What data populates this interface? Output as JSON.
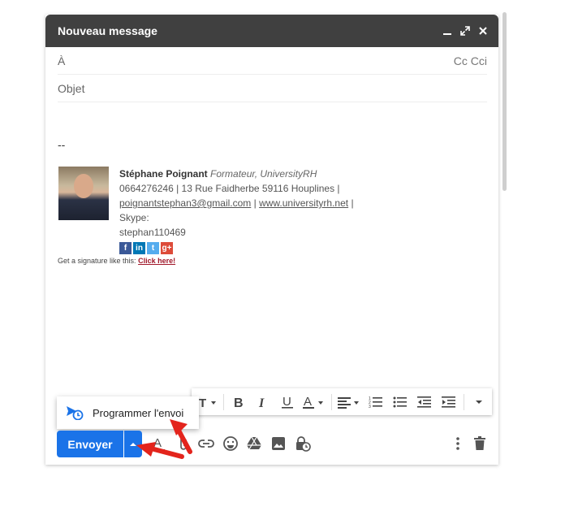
{
  "compose": {
    "title": "Nouveau message",
    "to_label": "À",
    "cc_bcc_label": "Cc Cci",
    "subject_placeholder": "Objet"
  },
  "signature": {
    "separator": "--",
    "name": "Stéphane Poignant",
    "role": "Formateur, UniversityRH",
    "line1": "0664276246 | 13 Rue Faidherbe 59116 Houplines |",
    "email": "poignantstephan3@gmail.com",
    "sep_pipe": " | ",
    "website": "www.universityrh.net",
    "skype_label": " | Skype:",
    "skype_id": "stephan110469",
    "social": [
      {
        "icon": "facebook-icon",
        "letter": "f",
        "color": "#3b5998"
      },
      {
        "icon": "linkedin-icon",
        "letter": "in",
        "color": "#0077b5"
      },
      {
        "icon": "twitter-icon",
        "letter": "t",
        "color": "#55acee"
      },
      {
        "icon": "google-plus-icon",
        "letter": "g+",
        "color": "#dd4b39"
      }
    ],
    "promo_text": "Get a signature like this:",
    "promo_link": "Click here!"
  },
  "popup": {
    "label": "Programmer l'envoi"
  },
  "toolbar": {
    "send_label": "Envoyer"
  },
  "colors": {
    "accent": "#1a73e8",
    "titlebar": "#404040",
    "annotation_arrow": "#e3241c"
  }
}
